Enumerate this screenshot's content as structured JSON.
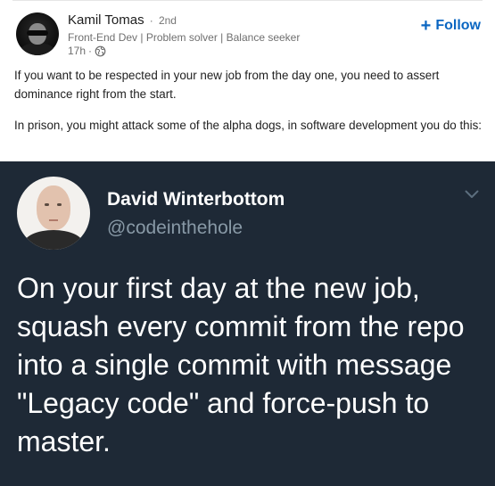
{
  "post": {
    "author": {
      "name": "Kamil Tomas",
      "separator": "·",
      "degree": "2nd",
      "tagline": "Front-End Dev | Problem solver | Balance seeker",
      "time": "17h",
      "time_separator": "·",
      "visibility_icon": "globe-icon"
    },
    "follow_label": "Follow",
    "follow_icon": "plus-icon",
    "paragraphs": [
      "If you want to be respected in your new job from the day one, you need to assert dominance right from the start.",
      "In prison, you might attack some of the alpha dogs, in software development you do this:"
    ]
  },
  "tweet": {
    "name": "David Winterbottom",
    "handle": "@codeinthehole",
    "menu_icon": "chevron-down-icon",
    "text": "On your first day at the new job, squash every commit from the repo into a single commit with message \"Legacy code\" and force-push to master."
  },
  "colors": {
    "accent": "#0a66c2",
    "tweet_background": "#1e2936",
    "tweet_handle": "#8899a6"
  }
}
